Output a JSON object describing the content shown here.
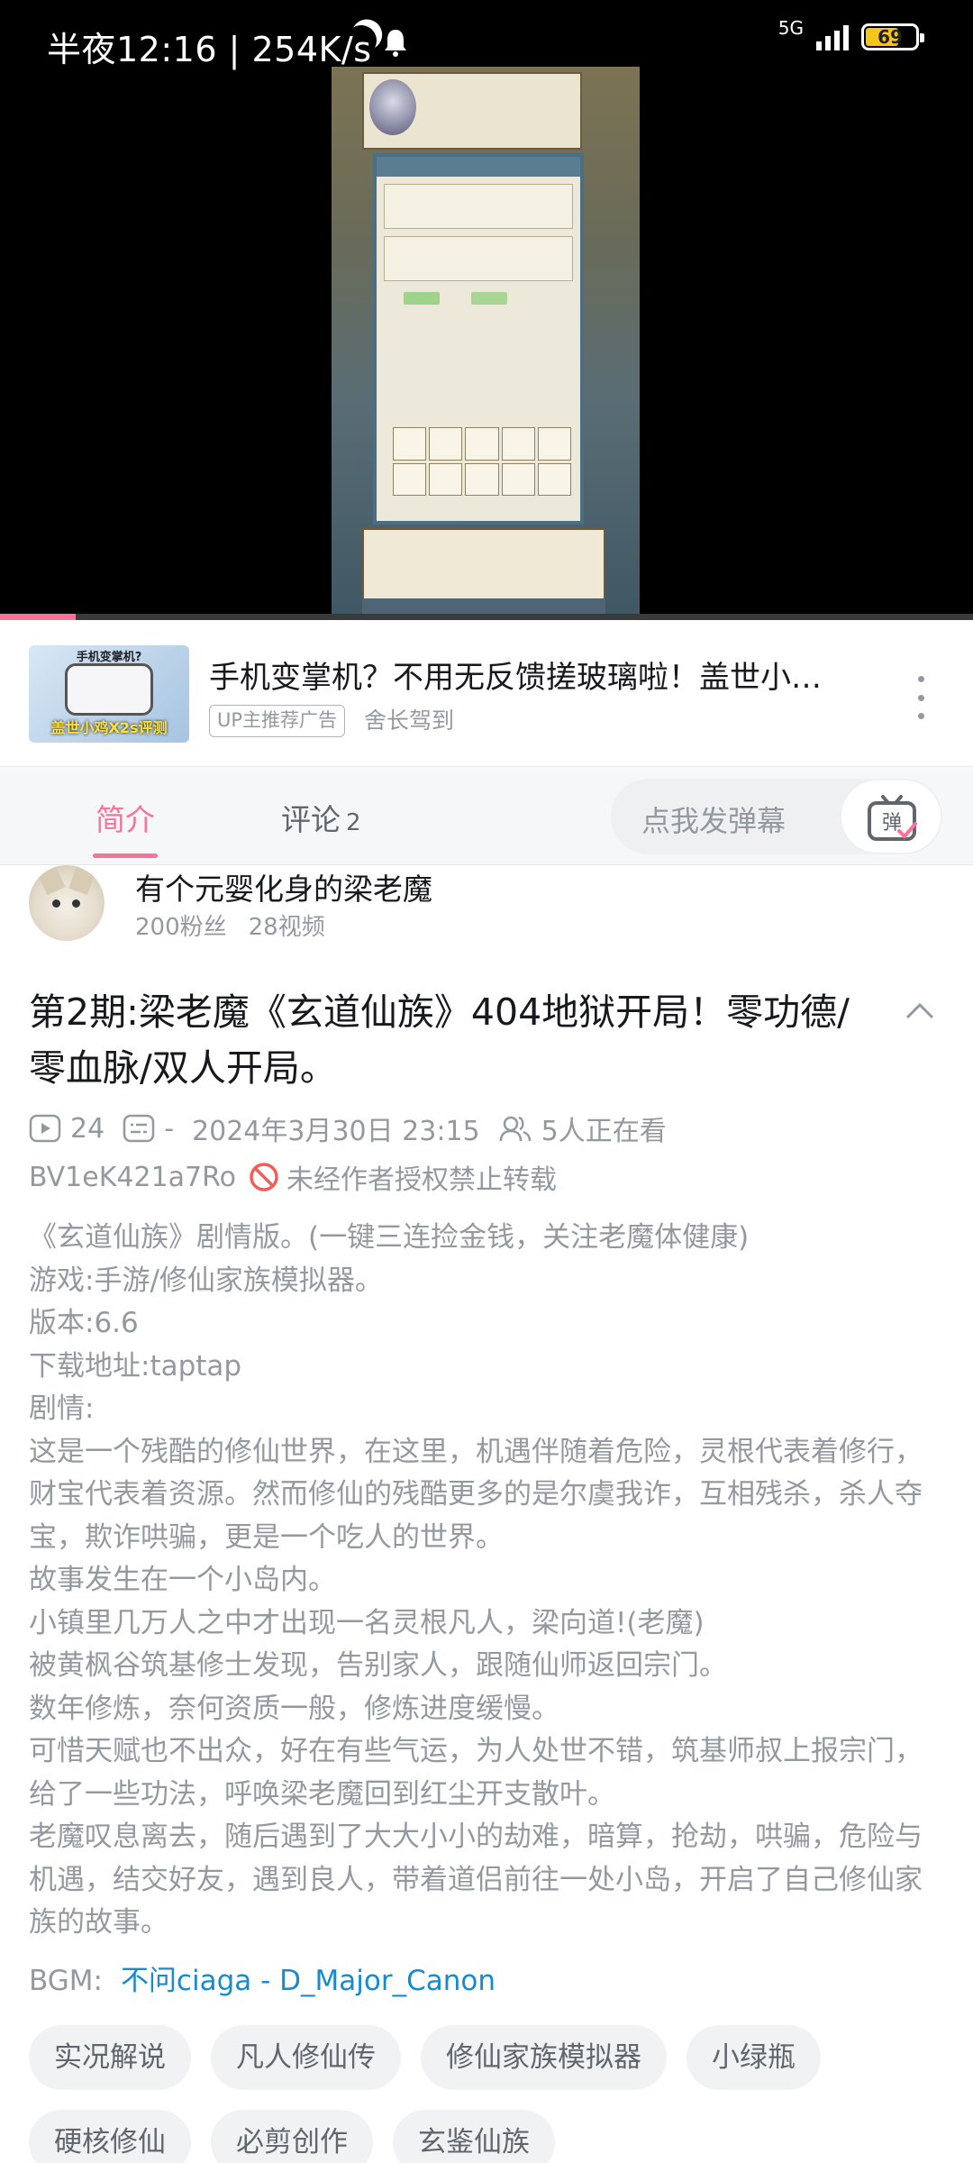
{
  "status_bar": {
    "time_text": "半夜12:16 | 254K/s",
    "network": "5G",
    "battery_level": "69",
    "battery_color": "#f5c518"
  },
  "video": {
    "progress_fraction": 0.078,
    "progress_color": "#fb7299"
  },
  "ad": {
    "thumb_caption_top": "手机变掌机?",
    "thumb_caption": "盖世小鸡X2s评测",
    "title": "手机变掌机？不用无反馈搓玻璃啦！盖世小…",
    "badge": "UP主推荐广告",
    "author": "舍长驾到"
  },
  "tabs": {
    "intro": "简介",
    "comments": "评论",
    "comments_count": "2",
    "danmaku_placeholder": "点我发弹幕",
    "danmaku_button": "弹",
    "accent": "#fb7299"
  },
  "uploader": {
    "name": "有个元婴化身的梁老魔",
    "fans": "200粉丝",
    "videos": "28视频"
  },
  "video_info": {
    "title": "第2期:梁老魔《玄道仙族》404地狱开局！零功德/零血脉/双人开局。",
    "plays": "24",
    "danmaku_count": "-",
    "date": "2024年3月30日 23:15",
    "watching": "5人正在看",
    "bvid": "BV1eK421a7Ro",
    "copyright_notice": "未经作者授权禁止转载"
  },
  "description": [
    "《玄道仙族》剧情版。(一键三连捡金钱，关注老魔体健康)",
    "游戏:手游/修仙家族模拟器。",
    "版本:6.6",
    "下载地址:taptap",
    "剧情:",
    "这是一个残酷的修仙世界，在这里，机遇伴随着危险，灵根代表着修行，财宝代表着资源。然而修仙的残酷更多的是尔虞我诈，互相残杀，杀人夺宝，欺诈哄骗，更是一个吃人的世界。",
    "故事发生在一个小岛内。",
    "小镇里几万人之中才出现一名灵根凡人，梁向道!(老魔)",
    "被黄枫谷筑基修士发现，告别家人，跟随仙师返回宗门。",
    "数年修炼，奈何资质一般，修炼进度缓慢。",
    "可惜天赋也不出众，好在有些气运，为人处世不错，筑基师叔上报宗门，给了一些功法，呼唤梁老魔回到红尘开支散叶。",
    "老魔叹息离去，随后遇到了大大小小的劫难，暗算，抢劫，哄骗，危险与机遇，结交好友，遇到良人，带着道侣前往一处小岛，开启了自己修仙家族的故事。"
  ],
  "bgm": {
    "label": "BGM:",
    "track": "不问ciaga - D_Major_Canon",
    "link_color": "#178bcf"
  },
  "tags": [
    "实况解说",
    "凡人修仙传",
    "修仙家族模拟器",
    "小绿瓶",
    "硬核修仙",
    "必剪创作",
    "玄鉴仙族"
  ]
}
